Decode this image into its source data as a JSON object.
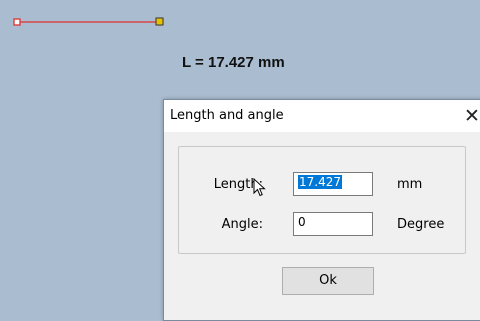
{
  "canvas": {
    "measurement_text": "L = 17.427 mm",
    "line_color": "#e03030",
    "start_handle_color": "#e03030",
    "end_handle_color": "#d4b000"
  },
  "dialog": {
    "title": "Length and angle",
    "close_glyph": "✕",
    "length_label": "Length:",
    "length_value": "17.427",
    "length_unit": "mm",
    "angle_label": "Angle:",
    "angle_value": "0",
    "angle_unit": "Degree",
    "ok_label": "Ok",
    "selection_color": "#0078d7"
  },
  "cursor_icon": "arrow-pointer-icon"
}
